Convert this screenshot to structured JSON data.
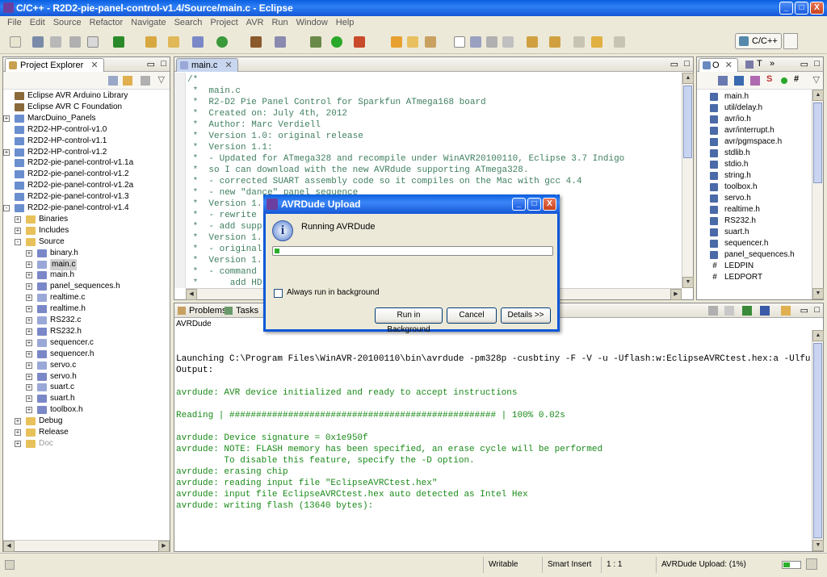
{
  "window": {
    "title": "C/C++ - R2D2-pie-panel-control-v1.4/Source/main.c - Eclipse",
    "min": "_",
    "max": "□",
    "close": "X"
  },
  "menu": [
    "File",
    "Edit",
    "Source",
    "Refactor",
    "Navigate",
    "Search",
    "Project",
    "AVR",
    "Run",
    "Window",
    "Help"
  ],
  "perspective": "C/C++",
  "explorer": {
    "tab": "Project Explorer",
    "items": [
      {
        "label": "Eclipse AVR Arduino Library",
        "depth": 0,
        "expand": "",
        "icon": "lib"
      },
      {
        "label": "Eclipse AVR C Foundation",
        "depth": 0,
        "expand": "",
        "icon": "lib"
      },
      {
        "label": "MarcDuino_Panels",
        "depth": 0,
        "expand": "+",
        "icon": "proj"
      },
      {
        "label": "R2D2-HP-control-v1.0",
        "depth": 0,
        "expand": "",
        "icon": "proj"
      },
      {
        "label": "R2D2-HP-control-v1.1",
        "depth": 0,
        "expand": "",
        "icon": "proj"
      },
      {
        "label": "R2D2-HP-control-v1.2",
        "depth": 0,
        "expand": "+",
        "icon": "proj"
      },
      {
        "label": "R2D2-pie-panel-control-v1.1a",
        "depth": 0,
        "expand": "",
        "icon": "proj"
      },
      {
        "label": "R2D2-pie-panel-control-v1.2",
        "depth": 0,
        "expand": "",
        "icon": "proj"
      },
      {
        "label": "R2D2-pie-panel-control-v1.2a",
        "depth": 0,
        "expand": "",
        "icon": "proj"
      },
      {
        "label": "R2D2-pie-panel-control-v1.3",
        "depth": 0,
        "expand": "",
        "icon": "proj"
      },
      {
        "label": "R2D2-pie-panel-control-v1.4",
        "depth": 0,
        "expand": "-",
        "icon": "proj"
      },
      {
        "label": "Binaries",
        "depth": 1,
        "expand": "+",
        "icon": "fold"
      },
      {
        "label": "Includes",
        "depth": 1,
        "expand": "+",
        "icon": "fold"
      },
      {
        "label": "Source",
        "depth": 1,
        "expand": "-",
        "icon": "fold"
      },
      {
        "label": "binary.h",
        "depth": 2,
        "expand": "+",
        "icon": "hfile"
      },
      {
        "label": "main.c",
        "depth": 2,
        "expand": "+",
        "icon": "cfile",
        "selected": true
      },
      {
        "label": "main.h",
        "depth": 2,
        "expand": "+",
        "icon": "hfile"
      },
      {
        "label": "panel_sequences.h",
        "depth": 2,
        "expand": "+",
        "icon": "hfile"
      },
      {
        "label": "realtime.c",
        "depth": 2,
        "expand": "+",
        "icon": "cfile"
      },
      {
        "label": "realtime.h",
        "depth": 2,
        "expand": "+",
        "icon": "hfile"
      },
      {
        "label": "RS232.c",
        "depth": 2,
        "expand": "+",
        "icon": "cfile"
      },
      {
        "label": "RS232.h",
        "depth": 2,
        "expand": "+",
        "icon": "hfile"
      },
      {
        "label": "sequencer.c",
        "depth": 2,
        "expand": "+",
        "icon": "cfile"
      },
      {
        "label": "sequencer.h",
        "depth": 2,
        "expand": "+",
        "icon": "hfile"
      },
      {
        "label": "servo.c",
        "depth": 2,
        "expand": "+",
        "icon": "cfile"
      },
      {
        "label": "servo.h",
        "depth": 2,
        "expand": "+",
        "icon": "hfile"
      },
      {
        "label": "suart.c",
        "depth": 2,
        "expand": "+",
        "icon": "cfile"
      },
      {
        "label": "suart.h",
        "depth": 2,
        "expand": "+",
        "icon": "hfile"
      },
      {
        "label": "toolbox.h",
        "depth": 2,
        "expand": "+",
        "icon": "hfile"
      },
      {
        "label": "Debug",
        "depth": 1,
        "expand": "+",
        "icon": "fold"
      },
      {
        "label": "Release",
        "depth": 1,
        "expand": "+",
        "icon": "fold"
      },
      {
        "label": "Doc",
        "depth": 1,
        "expand": "+",
        "icon": "fold",
        "dim": true
      }
    ]
  },
  "editor": {
    "tab": "main.c",
    "lines": [
      "/*",
      " *  main.c",
      " *  R2-D2 Pie Panel Control for Sparkfun ATmega168 board",
      " *  Created on: July 4th, 2012",
      " *  Author: Marc Verdiell",
      " *  Version 1.0: original release",
      " *  Version 1.1:",
      " *  - Updated for ATmega328 and recompile under WinAVR20100110, Eclipse 3.7 Indigo",
      " *  so I can download with the new AVRdude supporting ATmega328.",
      " *  - corrected SUART assembly code so it compiles on the Mac with gcc 4.4",
      " *  - new \"dance\" panel sequence",
      " *  Version 1.",
      " *  - rewrite                                               parsers",
      " *  - add supp",
      " *  Version 1.",
      " *  - original",
      " *  Version 1.",
      " *  - command",
      " *      add HD"
    ]
  },
  "outline": {
    "tab_o": "O",
    "tab_t": "T",
    "items": [
      {
        "label": "main.h",
        "icon": "inc"
      },
      {
        "label": "util/delay.h",
        "icon": "inc"
      },
      {
        "label": "avr/io.h",
        "icon": "inc"
      },
      {
        "label": "avr/interrupt.h",
        "icon": "inc"
      },
      {
        "label": "avr/pgmspace.h",
        "icon": "inc"
      },
      {
        "label": "stdlib.h",
        "icon": "inc"
      },
      {
        "label": "stdio.h",
        "icon": "inc"
      },
      {
        "label": "string.h",
        "icon": "inc"
      },
      {
        "label": "toolbox.h",
        "icon": "inc"
      },
      {
        "label": "servo.h",
        "icon": "inc"
      },
      {
        "label": "realtime.h",
        "icon": "inc"
      },
      {
        "label": "RS232.h",
        "icon": "inc"
      },
      {
        "label": "suart.h",
        "icon": "inc"
      },
      {
        "label": "sequencer.h",
        "icon": "inc"
      },
      {
        "label": "panel_sequences.h",
        "icon": "inc"
      },
      {
        "label": "LEDPIN",
        "icon": "hash"
      },
      {
        "label": "LEDPORT",
        "icon": "hash"
      }
    ]
  },
  "console": {
    "tab_problems": "Problems",
    "tab_tasks": "Tasks",
    "name": "AVRDude",
    "lines": [
      {
        "text": "",
        "color": "#000"
      },
      {
        "text": "Launching C:\\Program Files\\WinAVR-20100110\\bin\\avrdude -pm328p -cusbtiny -F -V -u -Uflash:w:EclipseAVRCtest.hex:a -Ulfu",
        "color": "#000"
      },
      {
        "text": "Output:",
        "color": "#000"
      },
      {
        "text": "",
        "color": "#000"
      },
      {
        "text": "avrdude: AVR device initialized and ready to accept instructions",
        "color": "#1a8a1a"
      },
      {
        "text": "",
        "color": "#000"
      },
      {
        "text": "Reading | ################################################## | 100% 0.02s",
        "color": "#1a8a1a"
      },
      {
        "text": "",
        "color": "#000"
      },
      {
        "text": "avrdude: Device signature = 0x1e950f",
        "color": "#1a8a1a"
      },
      {
        "text": "avrdude: NOTE: FLASH memory has been specified, an erase cycle will be performed",
        "color": "#1a8a1a"
      },
      {
        "text": "         To disable this feature, specify the -D option.",
        "color": "#1a8a1a"
      },
      {
        "text": "avrdude: erasing chip",
        "color": "#1a8a1a"
      },
      {
        "text": "avrdude: reading input file \"EclipseAVRCtest.hex\"",
        "color": "#1a8a1a"
      },
      {
        "text": "avrdude: input file EclipseAVRCtest.hex auto detected as Intel Hex",
        "color": "#1a8a1a"
      },
      {
        "text": "avrdude: writing flash (13640 bytes):",
        "color": "#1a8a1a"
      }
    ]
  },
  "dialog": {
    "title": "AVRDude Upload",
    "message": "Running AVRDude",
    "progress": 0.01,
    "checkbox": "Always run in background",
    "btn_background": "Run in Background",
    "btn_cancel": "Cancel",
    "btn_details": "Details >>"
  },
  "status": {
    "writable": "Writable",
    "insert": "Smart Insert",
    "position": "1 : 1",
    "task": "AVRDude Upload: (1%)"
  }
}
